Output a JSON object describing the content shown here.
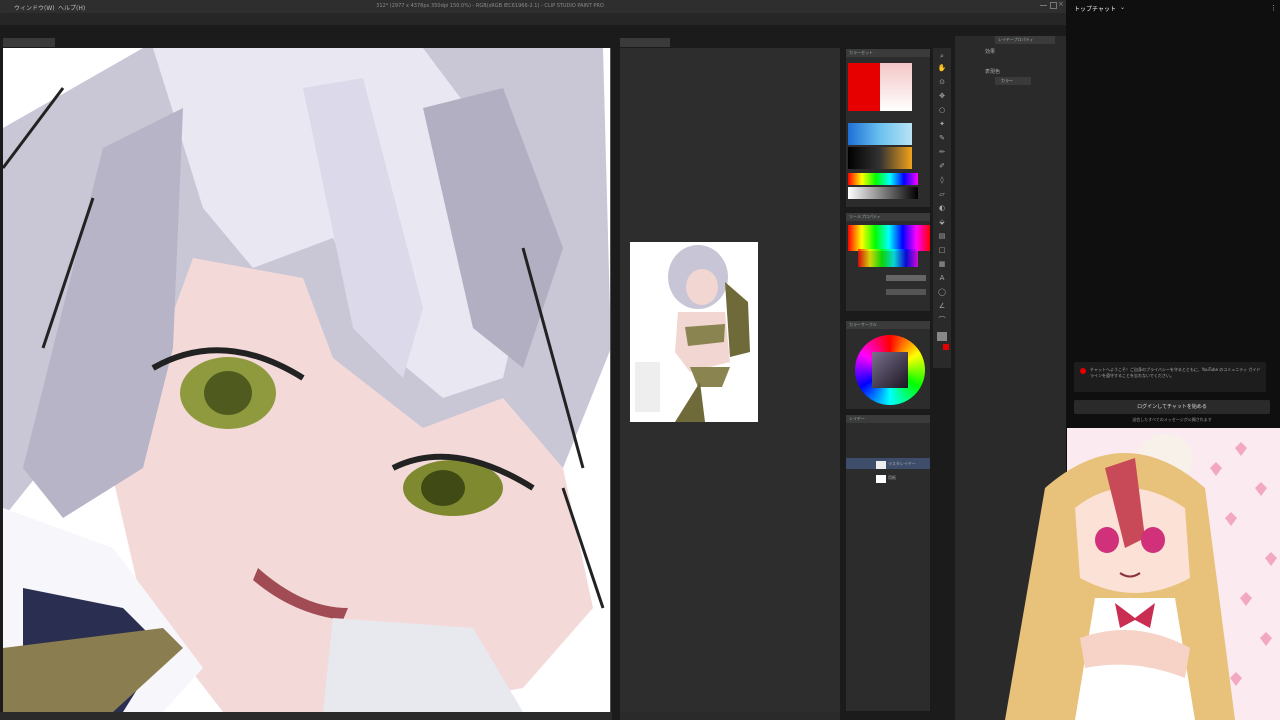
{
  "window": {
    "title": "312* (2977 x 4378px 350dpi 150.0%) - RGB(sRGB IEC61966-2.1) - CLIP STUDIO PAINT PRO"
  },
  "menu": {
    "items": [
      "ウィンドウ(W)",
      "ヘルプ(H)"
    ]
  },
  "panels": {
    "color_set_title": "カラーセット",
    "tool_property_title": "ツールプロパティ",
    "color_wheel_title": "カラーサークル",
    "layer_title": "レイヤー",
    "layer_property_title": "レイヤープロパティ",
    "effect_label": "効果",
    "expression_color_label": "表現色",
    "color_mode_value": "カラー",
    "layers": [
      {
        "name": "ラスタレイヤー"
      },
      {
        "name": "用紙"
      }
    ]
  },
  "chat": {
    "header": "トップチャット",
    "notice": "チャットへようこそ！ご自身のプライバシーを守るとともに、YouTube のコミュニティ ガイドラインを遵守することを忘れないでください。",
    "signin_button": "ログインしてチャットを始める",
    "signin_sub": "送信したすべてのメッセージが公開されます"
  },
  "colors": {
    "accent_red": "#e60000",
    "panel_bg": "#2c2c2c",
    "chat_bg": "#0f0f0f"
  }
}
